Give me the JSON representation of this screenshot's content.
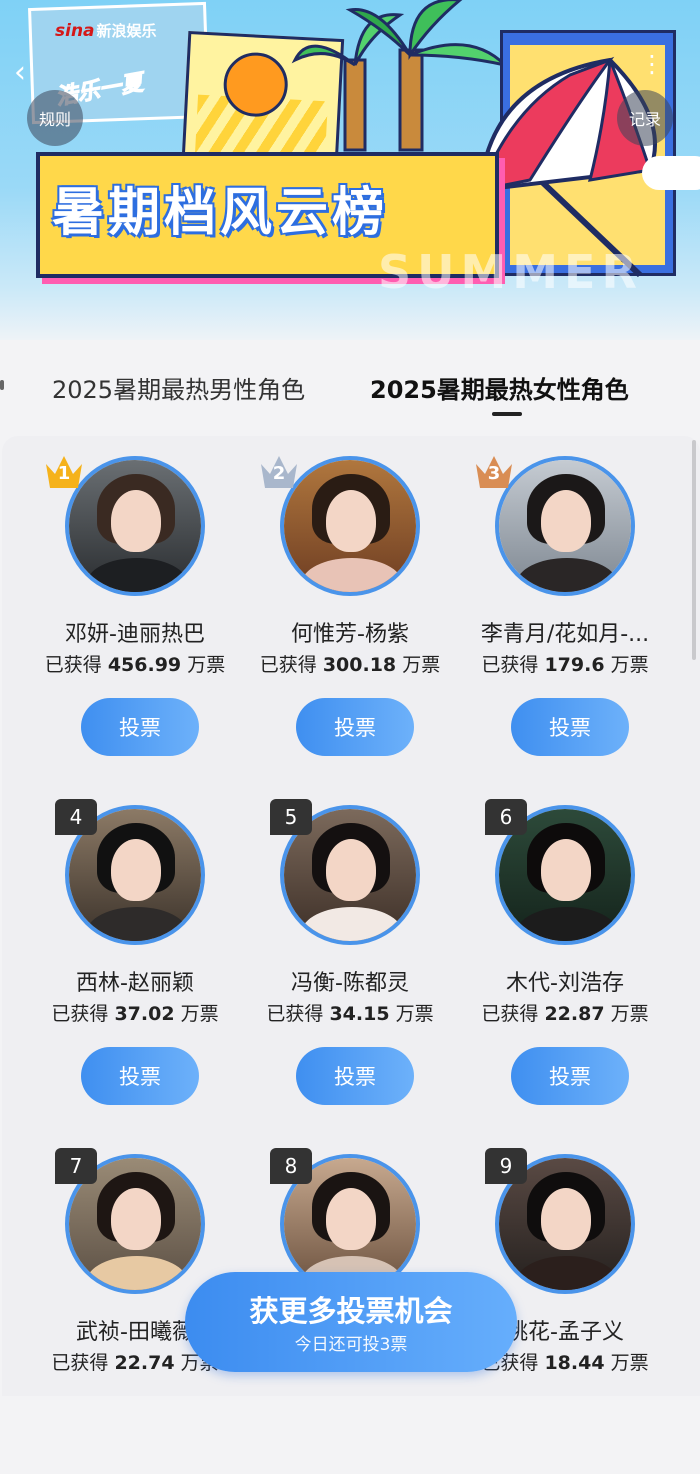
{
  "banner": {
    "brand_logo": "sina",
    "brand_name": "新浪娱乐",
    "sticker_text": "浩乐一夏",
    "title": "暑期档风云榜",
    "watermark": "SUMMER",
    "rules_label": "规则",
    "record_label": "记录"
  },
  "tabs": [
    {
      "label": "2025暑期最热男性角色",
      "active": false
    },
    {
      "label": "2025暑期最热女性角色",
      "active": true
    }
  ],
  "vote_button_label": "投票",
  "entries": [
    {
      "rank": "1",
      "name": "邓妍-迪丽热巴",
      "votes_prefix": "已获得",
      "votes": "456.99",
      "votes_unit": "万票"
    },
    {
      "rank": "2",
      "name": "何惟芳-杨紫",
      "votes_prefix": "已获得",
      "votes": "300.18",
      "votes_unit": "万票"
    },
    {
      "rank": "3",
      "name": "李青月/花如月-...",
      "votes_prefix": "已获得",
      "votes": "179.6",
      "votes_unit": "万票"
    },
    {
      "rank": "4",
      "name": "西林-赵丽颖",
      "votes_prefix": "已获得",
      "votes": "37.02",
      "votes_unit": "万票"
    },
    {
      "rank": "5",
      "name": "冯衡-陈都灵",
      "votes_prefix": "已获得",
      "votes": "34.15",
      "votes_unit": "万票"
    },
    {
      "rank": "6",
      "name": "木代-刘浩存",
      "votes_prefix": "已获得",
      "votes": "22.87",
      "votes_unit": "万票"
    },
    {
      "rank": "7",
      "name": "武祯-田曦薇",
      "votes_prefix": "已获得",
      "votes": "22.74",
      "votes_unit": "万票"
    },
    {
      "rank": "8",
      "name": "",
      "votes_prefix": "",
      "votes": "",
      "votes_unit": ""
    },
    {
      "rank": "9",
      "name": "桃花-孟子义",
      "votes_prefix": "已获得",
      "votes": "18.44",
      "votes_unit": "万票"
    }
  ],
  "cta": {
    "main": "获更多投票机会",
    "sub": "今日还可投3票"
  },
  "colors": {
    "accent": "#4a94ea",
    "gold": "#f5b21b",
    "silver": "#a9b7cc",
    "bronze": "#d98d54"
  }
}
